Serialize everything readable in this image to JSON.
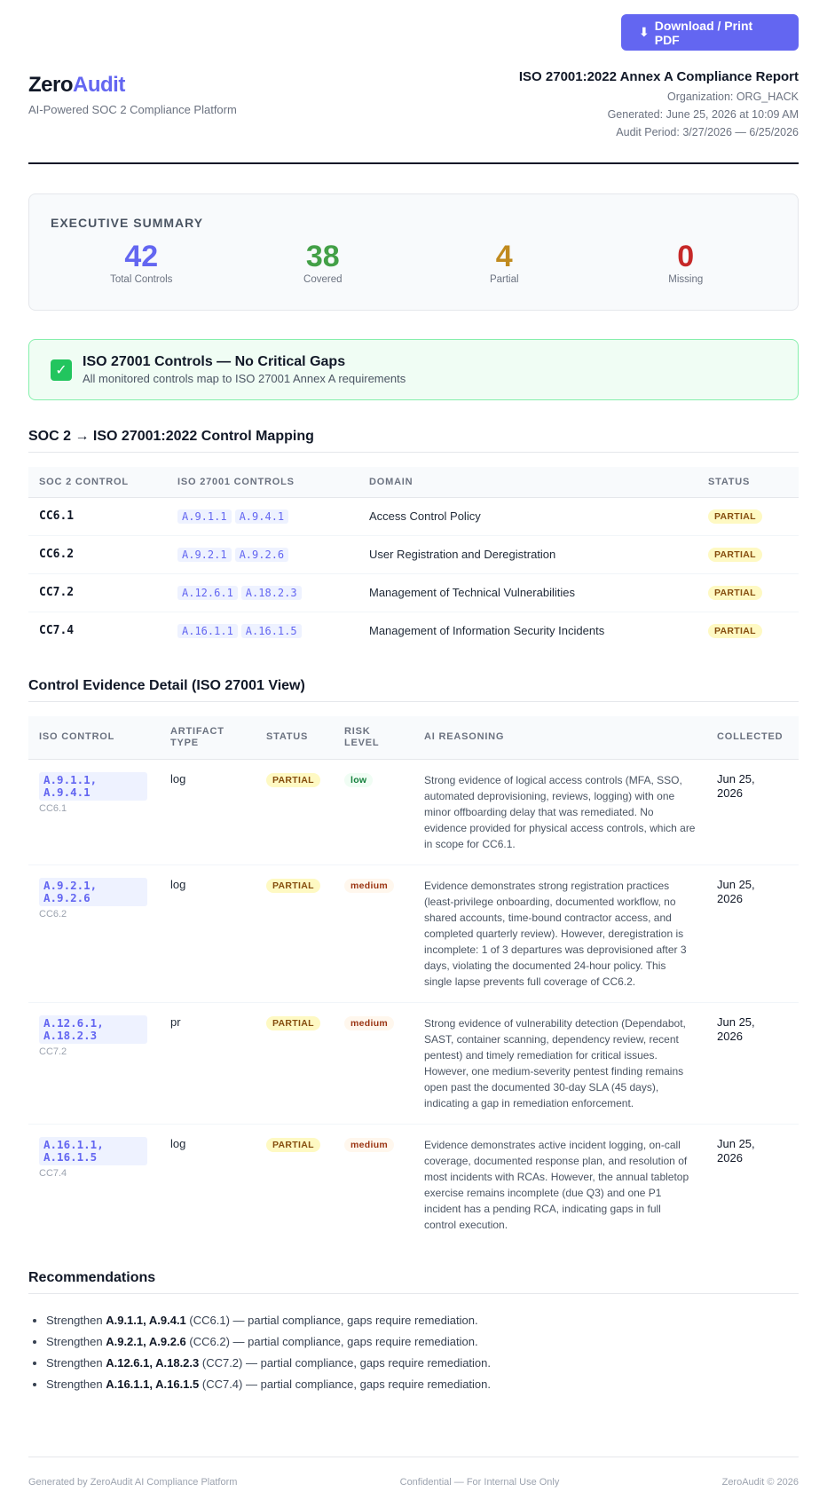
{
  "toolbar": {
    "download_label": "Download / Print PDF",
    "download_icon": "download-arrow-icon"
  },
  "brand": {
    "name_part1": "Zero",
    "name_part2": "Audit",
    "tagline": "AI-Powered SOC 2 Compliance Platform",
    "accent": "#6366f1"
  },
  "report": {
    "title": "ISO 27001:2022 Annex A Compliance Report",
    "organization": "Organization: ORG_HACK",
    "generated": "Generated: June 25, 2026 at 10:09 AM",
    "audit_period": "Audit Period: 3/27/2026 — 6/25/2026"
  },
  "summary": {
    "title": "EXECUTIVE SUMMARY",
    "stats": [
      {
        "value": "42",
        "label": "Total Controls",
        "color": "#6366f1"
      },
      {
        "value": "38",
        "label": "Covered",
        "color": "#43a047"
      },
      {
        "value": "4",
        "label": "Partial",
        "color": "#c08a1e"
      },
      {
        "value": "0",
        "label": "Missing",
        "color": "#c62828"
      }
    ]
  },
  "banner": {
    "icon": "check-icon",
    "title": "ISO 27001 Controls — No Critical Gaps",
    "subtitle": "All monitored controls map to ISO 27001 Annex A requirements"
  },
  "mapping": {
    "title": "SOC 2 → ISO 27001:2022 Control Mapping",
    "headers": [
      "SOC 2 CONTROL",
      "ISO 27001 CONTROLS",
      "DOMAIN",
      "STATUS"
    ],
    "rows": [
      {
        "soc": "CC6.1",
        "iso": [
          "A.9.1.1",
          "A.9.4.1"
        ],
        "domain": "Access Control Policy",
        "status": "PARTIAL"
      },
      {
        "soc": "CC6.2",
        "iso": [
          "A.9.2.1",
          "A.9.2.6"
        ],
        "domain": "User Registration and Deregistration",
        "status": "PARTIAL"
      },
      {
        "soc": "CC7.2",
        "iso": [
          "A.12.6.1",
          "A.18.2.3"
        ],
        "domain": "Management of Technical Vulnerabilities",
        "status": "PARTIAL"
      },
      {
        "soc": "CC7.4",
        "iso": [
          "A.16.1.1",
          "A.16.1.5"
        ],
        "domain": "Management of Information Security Incidents",
        "status": "PARTIAL"
      }
    ]
  },
  "evidence": {
    "title": "Control Evidence Detail (ISO 27001 View)",
    "headers": {
      "iso": "ISO CONTROL",
      "artifact_1": "ARTIFACT",
      "artifact_2": "TYPE",
      "status": "STATUS",
      "risk_1": "RISK",
      "risk_2": "LEVEL",
      "reason": "AI REASONING",
      "collected": "COLLECTED"
    },
    "rows": [
      {
        "iso_1": "A.9.1.1,",
        "iso_2": "A.9.4.1",
        "soc": "CC6.1",
        "artifact": "log",
        "status": "PARTIAL",
        "risk": "low",
        "reason": "Strong evidence of logical access controls (MFA, SSO, automated deprovisioning, reviews, logging) with one minor offboarding delay that was remediated. No evidence provided for physical access controls, which are in scope for CC6.1.",
        "collected_1": "Jun 25,",
        "collected_2": "2026"
      },
      {
        "iso_1": "A.9.2.1,",
        "iso_2": "A.9.2.6",
        "soc": "CC6.2",
        "artifact": "log",
        "status": "PARTIAL",
        "risk": "medium",
        "reason": "Evidence demonstrates strong registration practices (least-privilege onboarding, documented workflow, no shared accounts, time-bound contractor access, and completed quarterly review). However, deregistration is incomplete: 1 of 3 departures was deprovisioned after 3 days, violating the documented 24-hour policy. This single lapse prevents full coverage of CC6.2.",
        "collected_1": "Jun 25,",
        "collected_2": "2026"
      },
      {
        "iso_1": "A.12.6.1,",
        "iso_2": "A.18.2.3",
        "soc": "CC7.2",
        "artifact": "pr",
        "status": "PARTIAL",
        "risk": "medium",
        "reason": "Strong evidence of vulnerability detection (Dependabot, SAST, container scanning, dependency review, recent pentest) and timely remediation for critical issues. However, one medium-severity pentest finding remains open past the documented 30-day SLA (45 days), indicating a gap in remediation enforcement.",
        "collected_1": "Jun 25,",
        "collected_2": "2026"
      },
      {
        "iso_1": "A.16.1.1,",
        "iso_2": "A.16.1.5",
        "soc": "CC7.4",
        "artifact": "log",
        "status": "PARTIAL",
        "risk": "medium",
        "reason": "Evidence demonstrates active incident logging, on-call coverage, documented response plan, and resolution of most incidents with RCAs. However, the annual tabletop exercise remains incomplete (due Q3) and one P1 incident has a pending RCA, indicating gaps in full control execution.",
        "collected_1": "Jun 25,",
        "collected_2": "2026"
      }
    ]
  },
  "recommendations": {
    "title": "Recommendations",
    "items": [
      {
        "prefix": "Strengthen ",
        "controls": "A.9.1.1, A.9.4.1",
        "rest": " (CC6.1) — partial compliance, gaps require remediation."
      },
      {
        "prefix": "Strengthen ",
        "controls": "A.9.2.1, A.9.2.6",
        "rest": " (CC6.2) — partial compliance, gaps require remediation."
      },
      {
        "prefix": "Strengthen ",
        "controls": "A.12.6.1, A.18.2.3",
        "rest": " (CC7.2) — partial compliance, gaps require remediation."
      },
      {
        "prefix": "Strengthen ",
        "controls": "A.16.1.1, A.16.1.5",
        "rest": " (CC7.4) — partial compliance, gaps require remediation."
      }
    ]
  },
  "footer": {
    "left": "Generated by ZeroAudit AI Compliance Platform",
    "center": "Confidential — For Internal Use Only",
    "right": "ZeroAudit © 2026"
  }
}
